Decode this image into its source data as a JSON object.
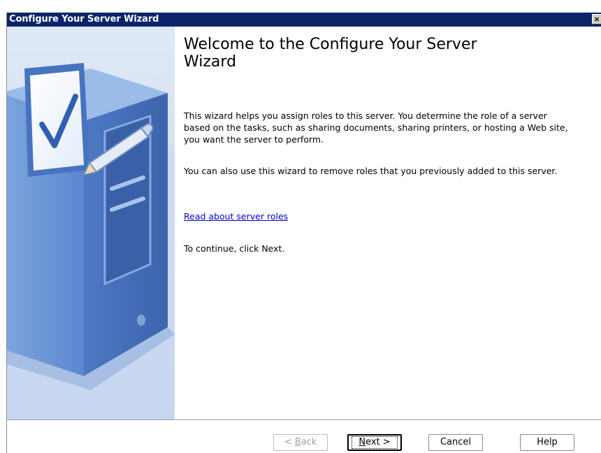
{
  "window": {
    "title": "Configure Your Server Wizard",
    "close_glyph": "×"
  },
  "content": {
    "heading": "Welcome to the Configure Your Server Wizard",
    "paragraph1": "This wizard helps you assign roles to this server. You determine the role of a server based on the tasks, such as sharing documents, sharing printers, or hosting a Web site, you want the server to perform.",
    "paragraph2": "You can also use this wizard to remove roles that you previously added to this server.",
    "link": "Read about server roles",
    "paragraph3": "To continue, click Next."
  },
  "buttons": {
    "back_prefix": "< ",
    "back_mnemonic": "B",
    "back_rest": "ack",
    "next_mnemonic": "N",
    "next_rest": "ext >",
    "cancel": "Cancel",
    "help": "Help"
  },
  "colors": {
    "titlebar": "#0a246a",
    "sidebar": "#d0ddf2",
    "link": "#0000cc"
  },
  "icons": {
    "sidebar_illustration": "server-checklist-icon",
    "close": "close-icon"
  }
}
